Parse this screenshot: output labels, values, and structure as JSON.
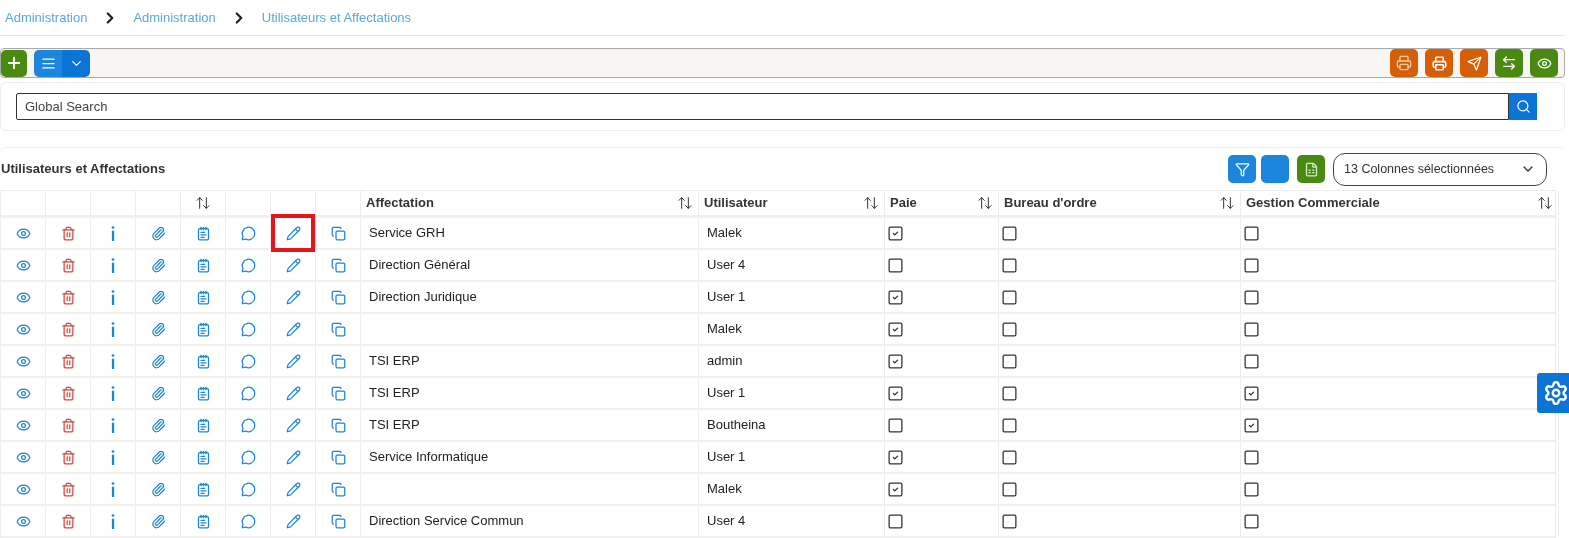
{
  "breadcrumb": [
    "Administration",
    "Administration",
    "Utilisateurs et Affectations"
  ],
  "search": {
    "placeholder": "Global Search"
  },
  "table_title": "Utilisateurs et Affectations",
  "column_selector": {
    "value": "13 Colonnes sélectionnées"
  },
  "columns": [
    {
      "label": "Affectation",
      "sortable": true
    },
    {
      "label": "Utilisateur",
      "sortable": true
    },
    {
      "label": "Paie",
      "sortable": true
    },
    {
      "label": "Bureau d'ordre",
      "sortable": true
    },
    {
      "label": "Gestion Commerciale",
      "sortable": true
    }
  ],
  "rows": [
    {
      "affectation": "Service GRH",
      "utilisateur": "Malek",
      "paie": true,
      "bureau_ordre": false,
      "gestion_commerciale": false,
      "edit_highlighted": true
    },
    {
      "affectation": "Direction Général",
      "utilisateur": "User 4",
      "paie": false,
      "bureau_ordre": false,
      "gestion_commerciale": false,
      "edit_highlighted": false
    },
    {
      "affectation": "Direction Juridique",
      "utilisateur": "User 1",
      "paie": true,
      "bureau_ordre": false,
      "gestion_commerciale": false,
      "edit_highlighted": false
    },
    {
      "utilisateur": "Malek",
      "paie": true,
      "bureau_ordre": false,
      "gestion_commerciale": false,
      "edit_highlighted": false
    },
    {
      "affectation": "TSI ERP",
      "utilisateur": "admin",
      "paie": true,
      "bureau_ordre": false,
      "gestion_commerciale": false,
      "edit_highlighted": false
    },
    {
      "affectation": "TSI ERP",
      "utilisateur": "User 1",
      "paie": true,
      "bureau_ordre": false,
      "gestion_commerciale": true,
      "edit_highlighted": false
    },
    {
      "affectation": "TSI ERP",
      "utilisateur": "Boutheina",
      "paie": false,
      "bureau_ordre": false,
      "gestion_commerciale": true,
      "edit_highlighted": false
    },
    {
      "affectation": "Service Informatique",
      "utilisateur": "User 1",
      "paie": true,
      "bureau_ordre": false,
      "gestion_commerciale": false,
      "edit_highlighted": false
    },
    {
      "utilisateur": "Malek",
      "paie": true,
      "bureau_ordre": false,
      "gestion_commerciale": false,
      "edit_highlighted": false
    },
    {
      "affectation": "Direction Service Commun",
      "utilisateur": "User 4",
      "paie": false,
      "bureau_ordre": false,
      "gestion_commerciale": false,
      "edit_highlighted": false
    }
  ]
}
